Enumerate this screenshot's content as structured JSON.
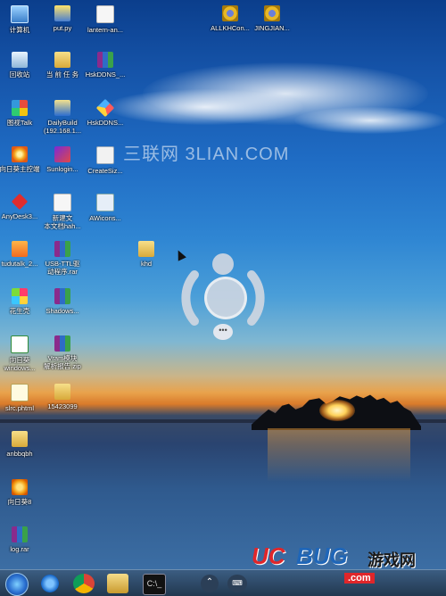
{
  "watermark": "三联网 3LIAN.COM",
  "desktop_icons": {
    "computer": "计算机",
    "put_py": "put.py",
    "lantern": "lantern-an...",
    "allkh": "ALLKHCon...",
    "jingjian": "JINGJIAN...",
    "recycle": "回收站",
    "folder_tasks": "当 前 任 务",
    "hskddns_rar": "HskDDNS_...",
    "talk": "图视Talk",
    "dailybuild_1": "DailyBuild",
    "dailybuild_2": "(192.168.1...",
    "hskddns": "HskDDNS...",
    "control": "向日葵主控端",
    "sunlogin": "Sunlogin...",
    "createsize": "CreateSiz...",
    "anydesk": "AnyDesk3...",
    "newdoc_1": "新建文",
    "newdoc_2": "本文档hah...",
    "awicons": "AWicons...",
    "tudou": "tudutalk_2...",
    "usb_1": "USB-TTL驱",
    "usb_2": "动程序.rar",
    "khd": "khd",
    "huashengke": "花生壳",
    "shadows": "Shadows...",
    "xiangrikui_win_1": "向日葵",
    "xiangrikui_win_2": "windows...",
    "vram_1": "Vram模块",
    "vram_2": "解析报告.zip",
    "slrc": "slrc.phtml",
    "folder_15423099": "15423099",
    "anbbqbh": "anbbqbh",
    "xiangrikui8": "向日葵8",
    "lograr": "log.rar"
  },
  "assistive_touch": {
    "more": "•••"
  },
  "taskbar": {
    "cmd_label": "C:\\_",
    "up_arrow": "⌃",
    "keyboard": "⌨"
  },
  "logo": {
    "uc": "UC",
    "bug": "BUG",
    "cn": "游戏网",
    "com": ".com"
  }
}
